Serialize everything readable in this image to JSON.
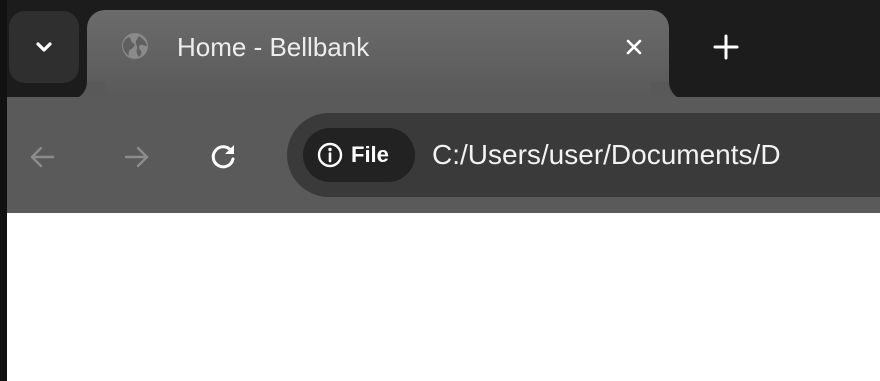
{
  "tabstrip": {
    "search_icon": "chevron-down-icon",
    "tab": {
      "title": "Home - Bellbank",
      "favicon": "globe-icon",
      "close_icon": "close-icon"
    },
    "new_tab_icon": "plus-icon"
  },
  "toolbar": {
    "back_icon": "arrow-left-icon",
    "forward_icon": "arrow-right-icon",
    "reload_icon": "reload-icon",
    "site_chip_label": "File",
    "site_chip_icon": "info-icon",
    "url": "C:/Users/user/Documents/D"
  },
  "colors": {
    "tabstrip_bg": "#1c1c1c",
    "active_tab_bg": "#595959",
    "toolbar_bg": "#5a5a5a",
    "omnibox_bg": "#3a3a3a",
    "chip_bg": "#222222"
  }
}
